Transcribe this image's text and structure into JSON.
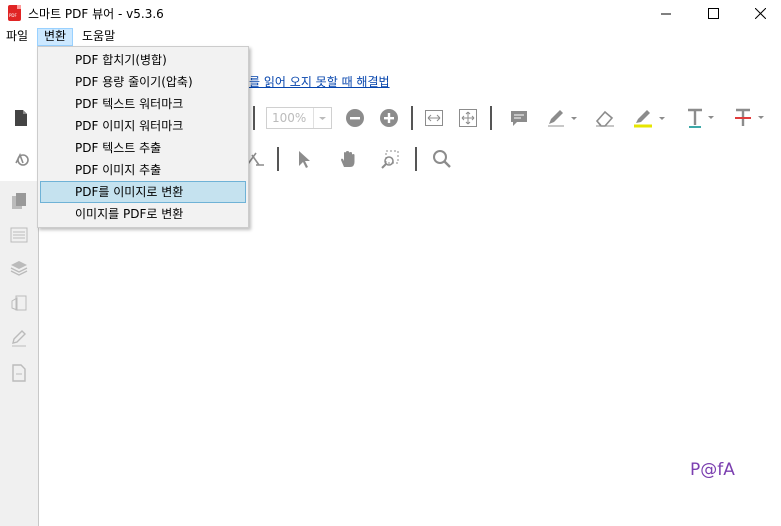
{
  "window": {
    "title": "스마트 PDF 뷰어 - v5.3.6",
    "app_icon_text": "PDF"
  },
  "menubar": {
    "file": "파일",
    "convert": "변환",
    "help": "도움말"
  },
  "convert_menu": {
    "items": [
      "PDF 합치기(병합)",
      "PDF 용량 줄이기(압축)",
      "PDF 텍스트 워터마크",
      "PDF 이미지 워터마크",
      "PDF 텍스트 추출",
      "PDF 이미지 추출",
      "PDF를 이미지로 변환",
      "이미지를 PDF로 변환"
    ],
    "highlighted_index": 6
  },
  "notice_link": "서를 읽어 오지 못할 때 해결법",
  "toolbar": {
    "zoom_value": "100%"
  },
  "watermark": "P@fA",
  "colors": {
    "menu_highlight": "#c5e2ef",
    "link": "#0645ad",
    "watermark": "#7b3fb0",
    "app_icon": "#e02424"
  }
}
